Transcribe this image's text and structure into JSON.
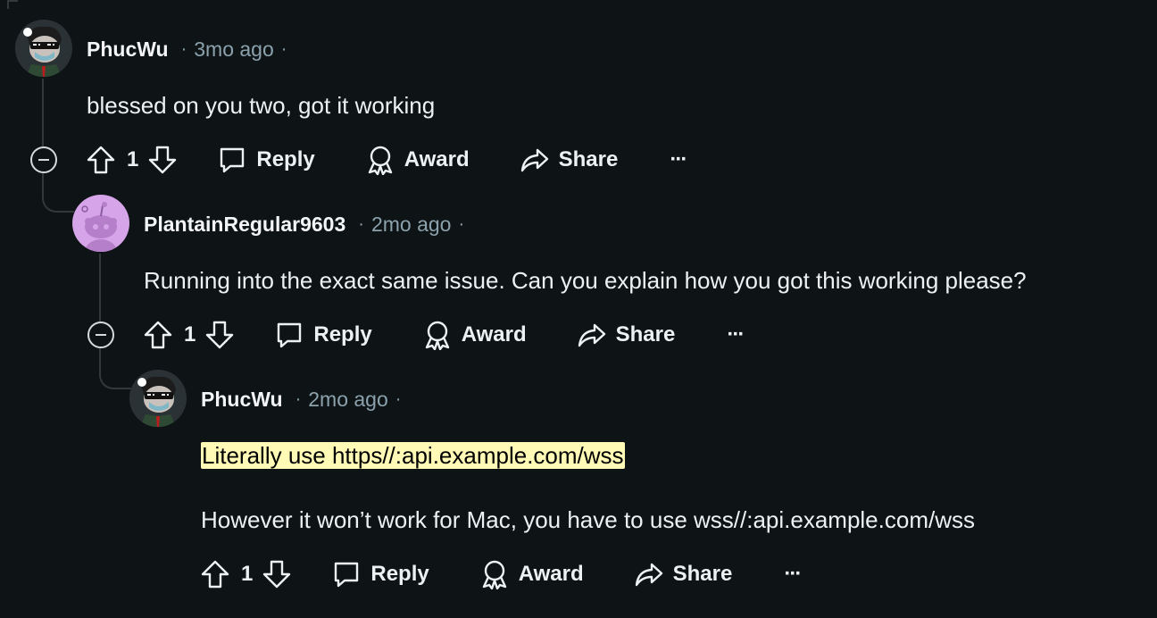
{
  "comments": [
    {
      "author": "PhucWu",
      "separator": "·",
      "time": "3mo ago",
      "body": "blessed on you two, got it working",
      "votes": "1",
      "reply": "Reply",
      "award": "Award",
      "share": "Share",
      "more": "···"
    },
    {
      "author": "PlantainRegular9603",
      "separator": "·",
      "time": "2mo ago",
      "body": "Running into the exact same issue. Can you explain how you got this working please?",
      "votes": "1",
      "reply": "Reply",
      "award": "Award",
      "share": "Share",
      "more": "···"
    },
    {
      "author": "PhucWu",
      "separator": "·",
      "time": "2mo ago",
      "body_highlight": "Literally use https//:api.example.com/wss",
      "body_line2": "However it won’t work for Mac, you have to use wss//:api.example.com/wss",
      "votes": "1",
      "reply": "Reply",
      "award": "Award",
      "share": "Share",
      "more": "···"
    }
  ],
  "colors": {
    "background": "#0e1416",
    "highlight": "#fffab5",
    "plantain_avatar": "#d6a4e9"
  }
}
